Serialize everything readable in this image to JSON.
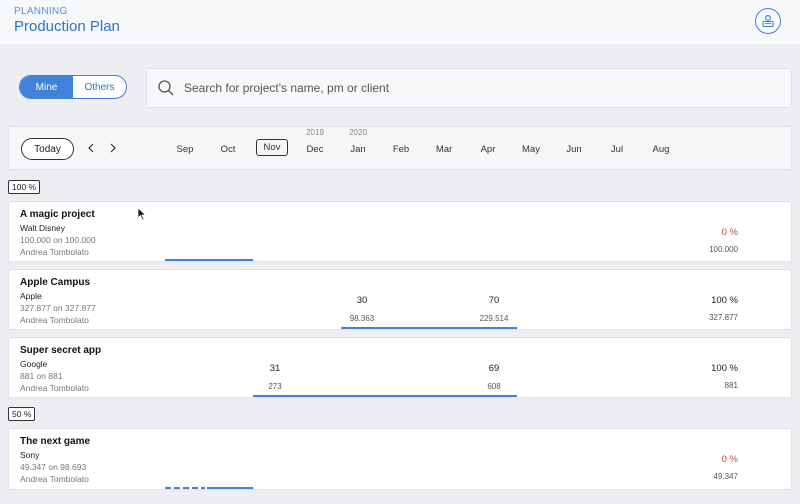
{
  "header": {
    "eyebrow": "PLANNING",
    "title": "Production Plan",
    "profile_icon": "user-icon"
  },
  "filter": {
    "mine_label": "Mine",
    "others_label": "Others",
    "active": "Mine"
  },
  "search": {
    "placeholder": "Search for project's name, pm or client"
  },
  "timeline": {
    "today_label": "Today",
    "prev_icon": "chevron-left-icon",
    "next_icon": "chevron-right-icon",
    "years": [
      "2019",
      "2020"
    ],
    "months": [
      "Sep",
      "Oct",
      "Nov",
      "Dec",
      "Jan",
      "Feb",
      "Mar",
      "Apr",
      "May",
      "Jun",
      "Jul",
      "Aug"
    ],
    "current_month": "Nov"
  },
  "groups": [
    {
      "badge": "100 %",
      "projects": [
        {
          "name": "A magic project",
          "client": "Walt Disney",
          "budget": "100.000 on 100.000",
          "pm": "Andrea Tombolato",
          "percent": "0 %",
          "total": "100.000",
          "months": []
        },
        {
          "name": "Apple Campus",
          "client": "Apple",
          "budget": "327.877 on 327.877",
          "pm": "Andrea Tombolato",
          "percent": "100 %",
          "total": "327.877",
          "months": [
            {
              "value": "30",
              "amount": "98.363"
            },
            {
              "value": "70",
              "amount": "229.514"
            }
          ]
        },
        {
          "name": "Super secret app",
          "client": "Google",
          "budget": "881 on 881",
          "pm": "Andrea Tombolato",
          "percent": "100 %",
          "total": "881",
          "months": [
            {
              "value": "31",
              "amount": "273"
            },
            {
              "value": "69",
              "amount": "608"
            }
          ]
        }
      ]
    },
    {
      "badge": "50 %",
      "projects": [
        {
          "name": "The next game",
          "client": "Sony",
          "budget": "49.347 on 98.693",
          "pm": "Andrea Tombolato",
          "percent": "0 %",
          "total": "49.347",
          "months": []
        }
      ]
    }
  ],
  "colors": {
    "accent": "#3f82d8",
    "title": "#2f73c9",
    "zero_percent": "#d0443a"
  }
}
